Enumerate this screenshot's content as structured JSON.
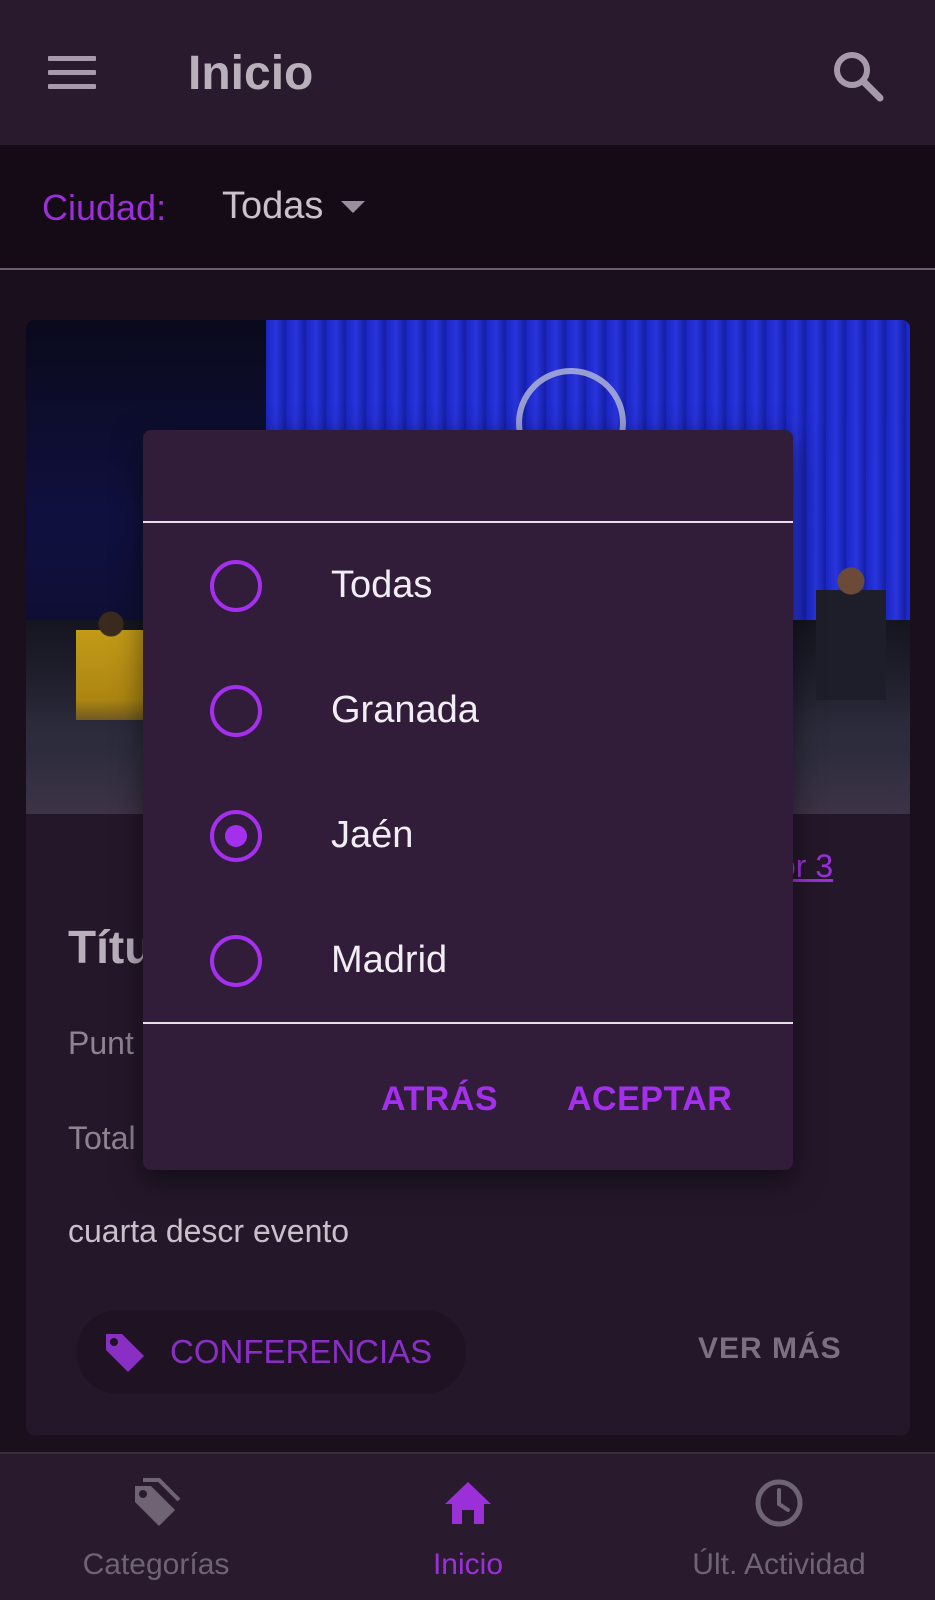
{
  "appbar": {
    "title": "Inicio",
    "menu_icon": "menu-icon",
    "search_icon": "search-icon"
  },
  "filter": {
    "label": "Ciudad:",
    "selected": "Todas"
  },
  "card": {
    "rating_text": "or 3",
    "title": "Títu",
    "line1": "Punt",
    "line2": "Total",
    "description": "cuarta descr evento",
    "category_chip": "CONFERENCIAS",
    "category_icon": "tag-icon",
    "ver_mas": "VER MÁS"
  },
  "dialog": {
    "options": [
      {
        "label": "Todas",
        "checked": false
      },
      {
        "label": "Granada",
        "checked": false
      },
      {
        "label": "Jaén",
        "checked": true
      },
      {
        "label": "Madrid",
        "checked": false
      }
    ],
    "back_label": "ATRÁS",
    "accept_label": "ACEPTAR"
  },
  "bottom_nav": {
    "items": [
      {
        "label": "Categorías",
        "icon": "tags-icon",
        "active": false
      },
      {
        "label": "Inicio",
        "icon": "home-icon",
        "active": true
      },
      {
        "label": "Últ. Actividad",
        "icon": "clock-icon",
        "active": false
      }
    ]
  },
  "colors": {
    "accent": "#9b30d9",
    "appbar_bg": "#2a1a2e",
    "dialog_bg": "#311d39",
    "page_bg": "#1a101d"
  }
}
